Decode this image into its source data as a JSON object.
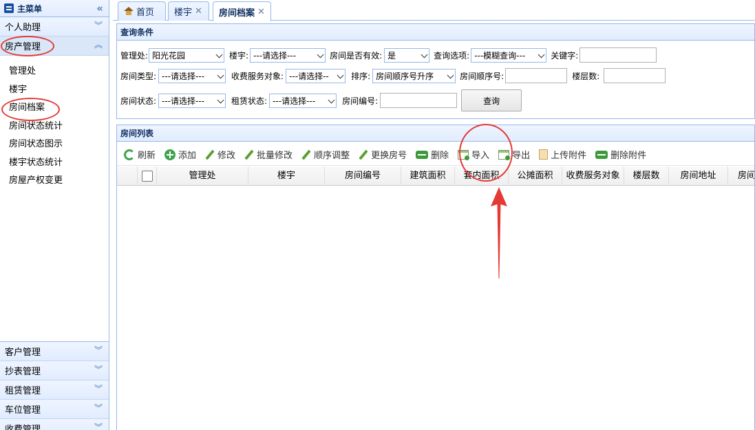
{
  "sidebar": {
    "title": "主菜单",
    "collapse_icon": "double-chevron-left-icon",
    "personal": "个人助理",
    "property": "房产管理",
    "items": [
      "管理处",
      "楼宇",
      "房间档案",
      "房间状态统计",
      "房间状态图示",
      "楼宇状态统计",
      "房屋产权变更"
    ],
    "bottom": [
      "客户管理",
      "抄表管理",
      "租赁管理",
      "车位管理",
      "收费管理"
    ]
  },
  "tabs": [
    {
      "label": "首页"
    },
    {
      "label": "楼宇"
    },
    {
      "label": "房间档案"
    }
  ],
  "query": {
    "title": "查询条件",
    "mgmt_label": "管理处:",
    "mgmt_value": "阳光花园",
    "building_label": "楼宇:",
    "building_value": "---请选择---",
    "valid_label": "房间是否有效:",
    "valid_value": "是",
    "option_label": "查询选项:",
    "option_value": "---模糊查询---",
    "keyword_label": "关键字:",
    "roomtype_label": "房间类型:",
    "roomtype_value": "---请选择---",
    "service_label": "收费服务对象:",
    "service_value": "---请选择--",
    "sort_label": "排序:",
    "sort_value": "房间顺序号升序",
    "order_label": "房间顺序号:",
    "floors_label": "楼层数:",
    "status_label": "房间状态:",
    "status_value": "---请选择---",
    "rent_label": "租赁状态:",
    "rent_value": "---请选择---",
    "roomno_label": "房间编号:",
    "query_btn": "查询"
  },
  "list": {
    "title": "房间列表",
    "toolbar": [
      "刷新",
      "添加",
      "修改",
      "批量修改",
      "顺序调整",
      "更换房号",
      "删除",
      "导入",
      "导出",
      "上传附件",
      "删除附件"
    ],
    "columns": [
      "管理处",
      "楼宇",
      "房间编号",
      "建筑面积",
      "套内面积",
      "公摊面积",
      "收费服务对象",
      "楼层数",
      "房间地址",
      "房间"
    ]
  },
  "annotations": {
    "highlight_color": "#e53935"
  }
}
